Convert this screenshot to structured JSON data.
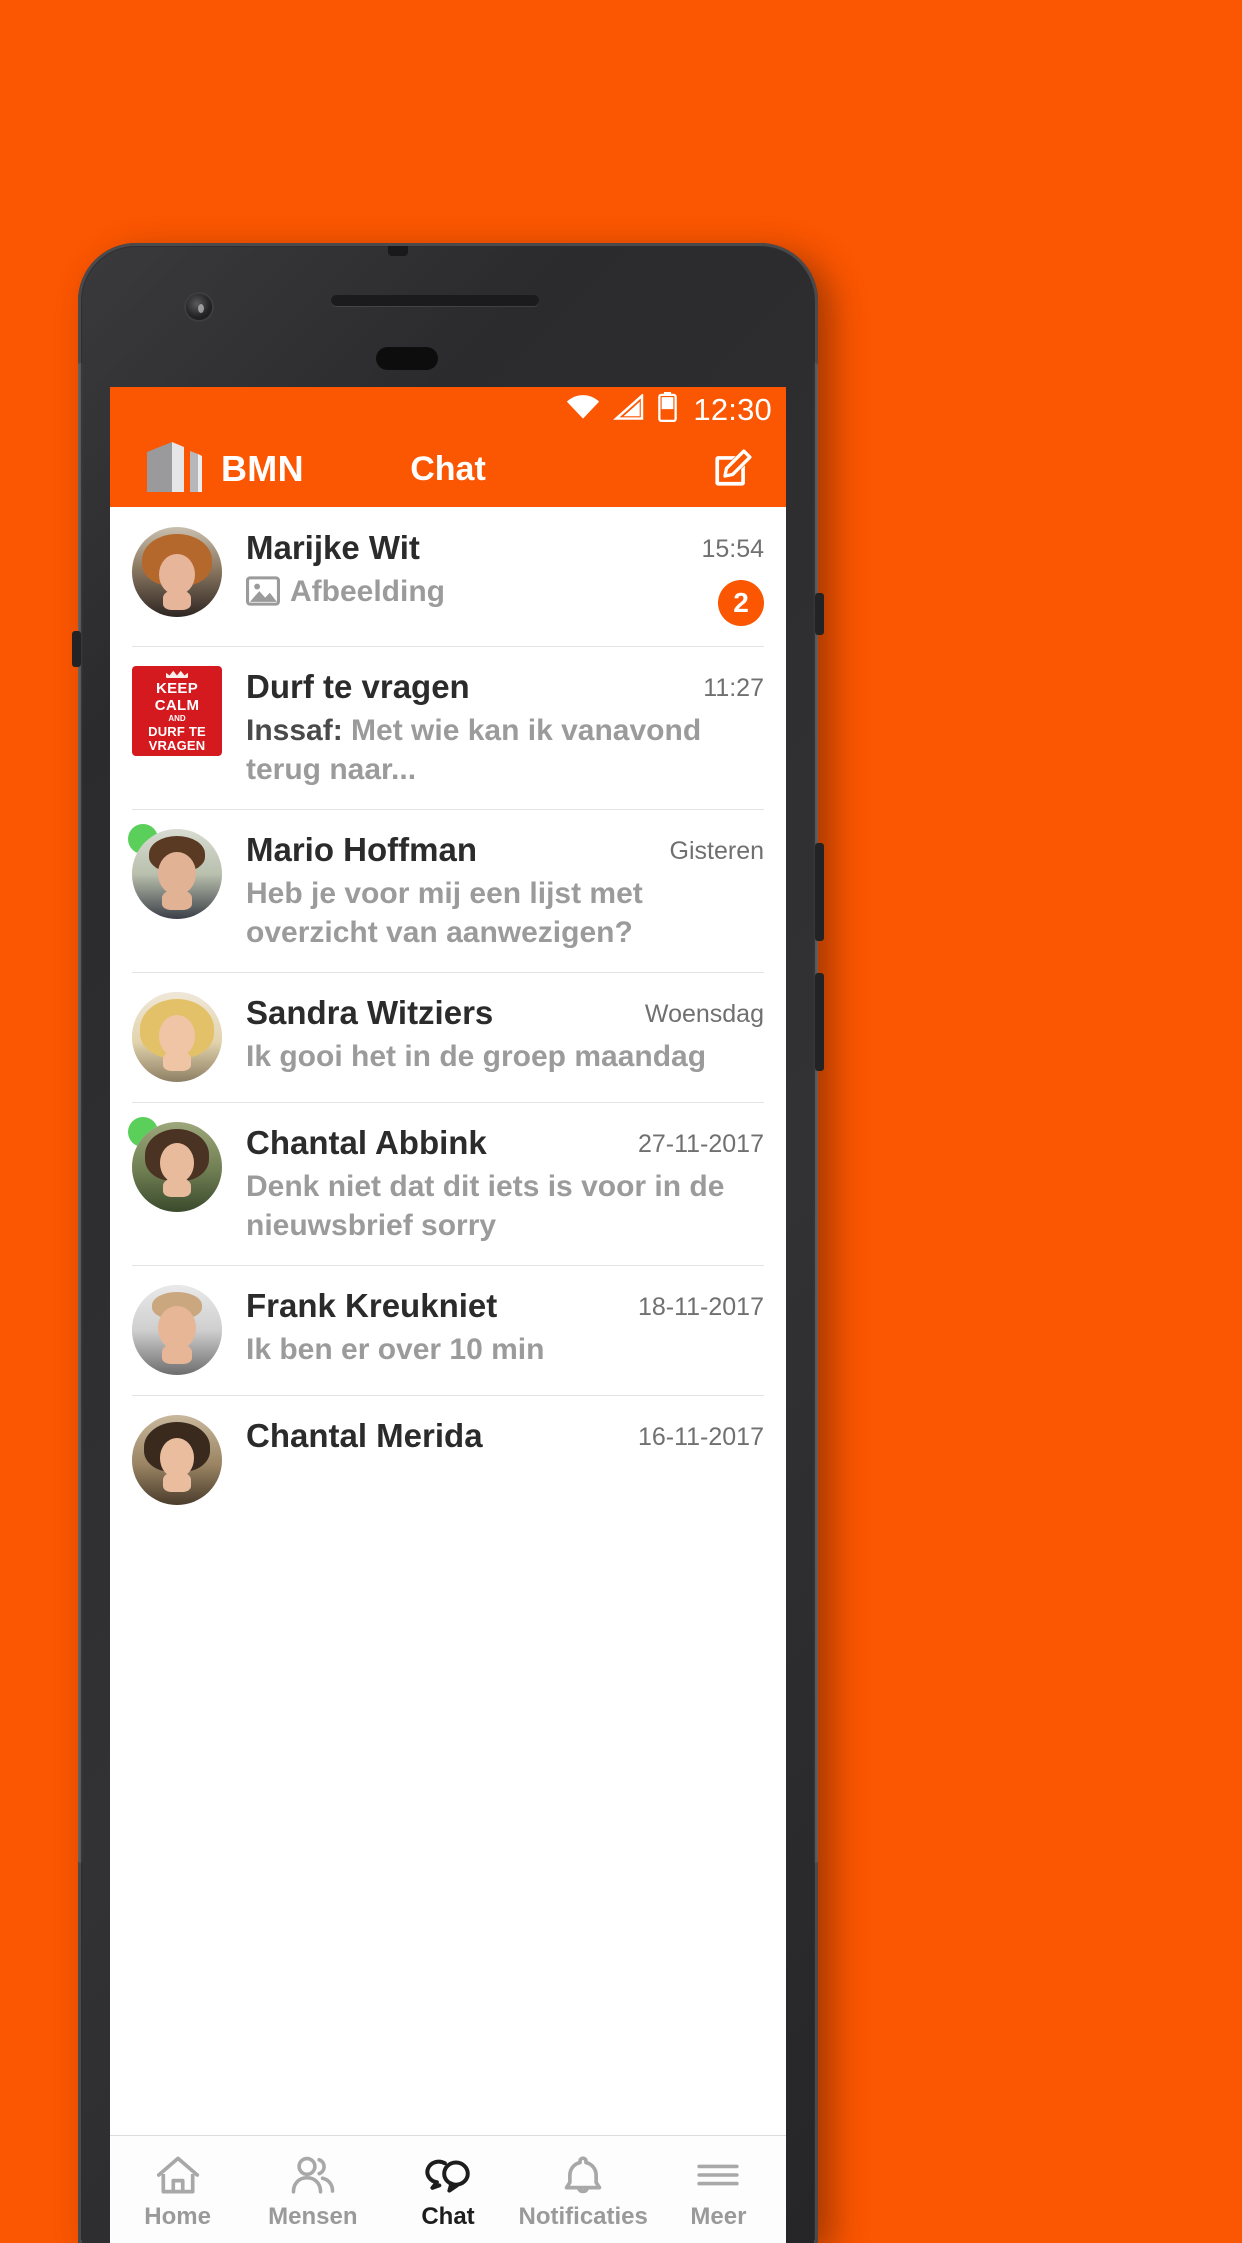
{
  "statusbar": {
    "time": "12:30",
    "icons": [
      "wifi-icon",
      "cellular-signal-icon",
      "battery-icon"
    ]
  },
  "appbar": {
    "brand": "BMN",
    "logo_icon": "bmn-building-logo",
    "title": "Chat",
    "compose_icon": "compose-pencil-icon"
  },
  "theme": {
    "accent": "#FB5601",
    "online": "#5ACF5A",
    "name_color": "#2b2b2b",
    "preview_color": "#9b9b9b",
    "time_color": "#707070"
  },
  "chats": [
    {
      "name": "Marijke Wit",
      "time": "15:54",
      "preview": "Afbeelding",
      "preview_icon": "image-attachment-icon",
      "sender": "",
      "badge": "2",
      "online": false,
      "avatar_type": "photo",
      "avatar_name": "avatar-marijke-wit"
    },
    {
      "name": "Durf te vragen",
      "time": "11:27",
      "preview": "Met wie kan ik vanavond terug naar...",
      "preview_icon": "",
      "sender": "Inssaf:",
      "badge": "",
      "online": false,
      "avatar_type": "poster",
      "avatar_name": "avatar-durf-te-vragen-poster",
      "poster": {
        "line1": "KEEP",
        "line2": "CALM",
        "line3": "AND",
        "line4": "DURF TE",
        "line5": "VRAGEN"
      }
    },
    {
      "name": "Mario Hoffman",
      "time": "Gisteren",
      "preview": "Heb je voor mij een lijst met overzicht van aanwezigen?",
      "preview_icon": "",
      "sender": "",
      "badge": "",
      "online": true,
      "avatar_type": "photo",
      "avatar_name": "avatar-mario-hoffman"
    },
    {
      "name": "Sandra Witziers",
      "time": "Woensdag",
      "preview": "Ik gooi het in de groep maandag",
      "preview_icon": "",
      "sender": "",
      "badge": "",
      "online": false,
      "avatar_type": "photo",
      "avatar_name": "avatar-sandra-witziers"
    },
    {
      "name": "Chantal Abbink",
      "time": "27-11-2017",
      "preview": "Denk niet dat dit iets is voor in de nieuwsbrief sorry",
      "preview_icon": "",
      "sender": "",
      "badge": "",
      "online": true,
      "avatar_type": "photo",
      "avatar_name": "avatar-chantal-abbink"
    },
    {
      "name": "Frank Kreukniet",
      "time": "18-11-2017",
      "preview": "Ik ben er over 10 min",
      "preview_icon": "",
      "sender": "",
      "badge": "",
      "online": false,
      "avatar_type": "photo",
      "avatar_name": "avatar-frank-kreukniet"
    },
    {
      "name": "Chantal Merida",
      "time": "16-11-2017",
      "preview": "",
      "preview_icon": "",
      "sender": "",
      "badge": "",
      "online": false,
      "avatar_type": "photo",
      "avatar_name": "avatar-chantal-merida"
    }
  ],
  "bottom_nav": [
    {
      "label": "Home",
      "icon": "home-icon",
      "active": false
    },
    {
      "label": "Mensen",
      "icon": "people-icon",
      "active": false
    },
    {
      "label": "Chat",
      "icon": "chat-bubbles-icon",
      "active": true
    },
    {
      "label": "Notificaties",
      "icon": "bell-icon",
      "active": false
    },
    {
      "label": "Meer",
      "icon": "hamburger-menu-icon",
      "active": false
    }
  ]
}
